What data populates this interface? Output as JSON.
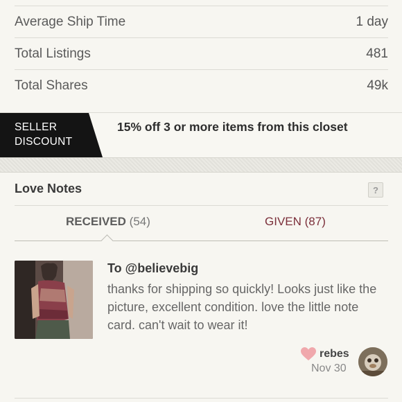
{
  "stats": [
    {
      "label": "Average Ship Time",
      "value": "1 day"
    },
    {
      "label": "Total Listings",
      "value": "481"
    },
    {
      "label": "Total Shares",
      "value": "49k"
    }
  ],
  "discount": {
    "tag_line1": "SELLER",
    "tag_line2": "DISCOUNT",
    "text": "15% off 3 or more items from this closet"
  },
  "love_notes": {
    "title": "Love Notes",
    "help": "?",
    "tabs": {
      "received_label": "RECEIVED",
      "received_count": "(54)",
      "given_label": "GIVEN",
      "given_count": "(87)"
    },
    "note": {
      "to": "To @believebig",
      "body": "thanks for shipping so quickly! Looks just like the picture, excellent condition. love the little note card. can't wait to wear it!",
      "author": "rebes",
      "date": "Nov 30",
      "heart_color": "#f0a8ac",
      "icon": "heart-icon"
    }
  },
  "colors": {
    "background": "#f7f6f1",
    "given_tab": "#7b2f3a",
    "discount_tag": "#141414"
  }
}
